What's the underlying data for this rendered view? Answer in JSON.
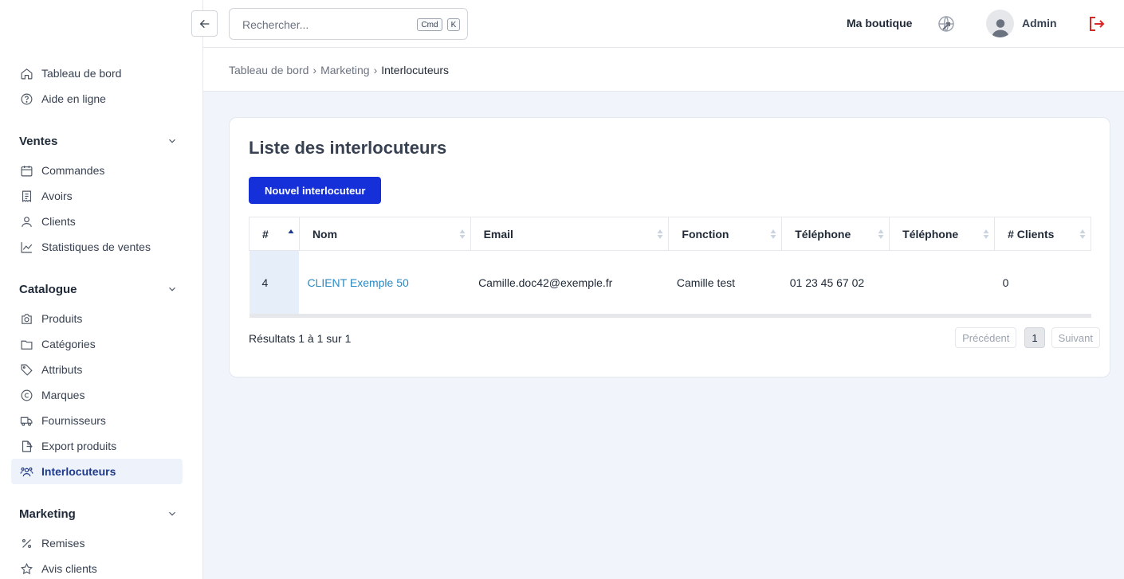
{
  "search": {
    "placeholder": "Rechercher...",
    "kbd1": "Cmd",
    "kbd2": "K"
  },
  "header": {
    "shop": "Ma boutique",
    "user": "Admin"
  },
  "sidebar": {
    "top": [
      {
        "label": "Tableau de bord",
        "icon": "home-icon"
      },
      {
        "label": "Aide en ligne",
        "icon": "help-icon"
      }
    ],
    "sections": [
      {
        "title": "Ventes",
        "items": [
          {
            "label": "Commandes",
            "icon": "calendar-icon"
          },
          {
            "label": "Avoirs",
            "icon": "receipt-icon"
          },
          {
            "label": "Clients",
            "icon": "user-icon"
          },
          {
            "label": "Statistiques de ventes",
            "icon": "chart-icon"
          }
        ]
      },
      {
        "title": "Catalogue",
        "items": [
          {
            "label": "Produits",
            "icon": "camera-icon"
          },
          {
            "label": "Catégories",
            "icon": "folder-icon"
          },
          {
            "label": "Attributs",
            "icon": "tag-icon"
          },
          {
            "label": "Marques",
            "icon": "copyright-icon"
          },
          {
            "label": "Fournisseurs",
            "icon": "truck-icon"
          },
          {
            "label": "Export produits",
            "icon": "export-icon"
          },
          {
            "label": "Interlocuteurs",
            "icon": "users-icon",
            "active": true
          }
        ]
      },
      {
        "title": "Marketing",
        "items": [
          {
            "label": "Remises",
            "icon": "percent-icon"
          },
          {
            "label": "Avis clients",
            "icon": "star-icon"
          }
        ]
      }
    ]
  },
  "breadcrumb": {
    "item1": "Tableau de bord",
    "item2": "Marketing",
    "current": "Interlocuteurs",
    "sep": "›"
  },
  "main": {
    "title": "Liste des interlocuteurs",
    "new_button": "Nouvel interlocuteur",
    "table": {
      "columns": [
        "#",
        "Nom",
        "Email",
        "Fonction",
        "Téléphone",
        "Téléphone",
        "# Clients"
      ],
      "rows": [
        {
          "id": "4",
          "name": "CLIENT Exemple 50",
          "email": "Camille.doc42@exemple.fr",
          "function": "Camille test",
          "phone1": "01 23 45 67 02",
          "phone2": "",
          "clients": "0"
        }
      ]
    },
    "results": "Résultats 1 à 1 sur 1",
    "pagination": {
      "prev": "Précédent",
      "page": "1",
      "next": "Suivant"
    }
  },
  "colors": {
    "primary": "#1530d9",
    "link": "#2b8ac2",
    "logout": "#dc2626",
    "active_bg": "#eef2fb"
  }
}
